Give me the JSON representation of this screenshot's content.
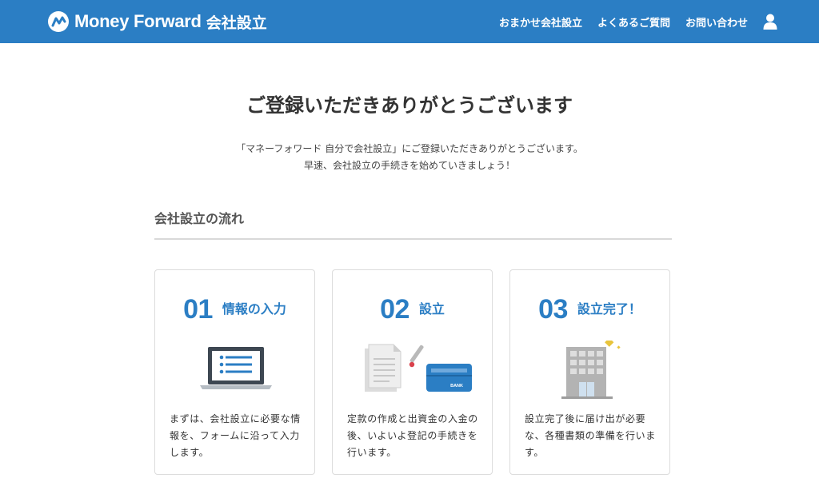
{
  "header": {
    "logo_text": "Money Forward",
    "logo_sub": "会社設立",
    "nav": [
      "おまかせ会社設立",
      "よくあるご質問",
      "お問い合わせ"
    ],
    "brand_color": "#2b7ec4"
  },
  "main": {
    "title": "ご登録いただきありがとうございます",
    "lead_line1": "「マネーフォワード 自分で会社設立」にご登録いただきありがとうございます。",
    "lead_line2": "早速、会社設立の手続きを始めていきましょう！",
    "section_title": "会社設立の流れ"
  },
  "steps": [
    {
      "num": "01",
      "label": "情報の入力",
      "text": "まずは、会社設立に必要な情報を、フォームに沿って入力します。",
      "icon": "laptop-icon"
    },
    {
      "num": "02",
      "label": "設立",
      "text": "定款の作成と出資金の入金の後、いよいよ登記の手続きを行います。",
      "icon": "documents-bank-icon",
      "bank_text": "BANK"
    },
    {
      "num": "03",
      "label": "設立完了！",
      "text": "設立完了後に届け出が必要な、各種書類の準備を行います。",
      "icon": "building-icon"
    }
  ]
}
